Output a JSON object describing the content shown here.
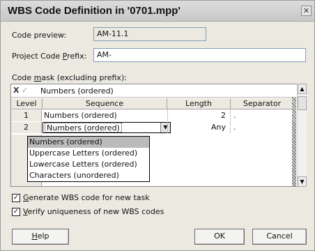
{
  "window": {
    "title": "WBS Code Definition in '0701.mpp'"
  },
  "code_preview": {
    "label": "Code preview:",
    "value": "AM-11.1"
  },
  "prefix": {
    "label_pre": "Project Code ",
    "label_u": "P",
    "label_post": "refix:",
    "value": "AM-"
  },
  "mask": {
    "label_pre": "Code ",
    "label_u": "m",
    "label_post": "ask (excluding prefix):",
    "edit_value": "Numbers (ordered)",
    "edit_cancel": "X",
    "edit_accept": "✓"
  },
  "table": {
    "headers": [
      "Level",
      "Sequence",
      "Length",
      "Separator"
    ],
    "rows": [
      {
        "level": "1",
        "sequence": "Numbers (ordered)",
        "length": "2",
        "separator": "."
      },
      {
        "level": "2",
        "sequence": "Numbers (ordered)",
        "length": "Any",
        "separator": "."
      }
    ]
  },
  "dropdown": {
    "options": [
      "Numbers (ordered)",
      "Uppercase Letters (ordered)",
      "Lowercase Letters (ordered)",
      "Characters (unordered)"
    ],
    "selected_index": 0
  },
  "options": [
    {
      "pre": "",
      "u": "G",
      "post": "enerate WBS code for new task",
      "checked": true
    },
    {
      "pre": "",
      "u": "V",
      "post": "erify uniqueness of new WBS codes",
      "checked": true
    }
  ],
  "buttons": {
    "help_u": "H",
    "help_rest": "elp",
    "ok": "OK",
    "cancel": "Cancel"
  }
}
